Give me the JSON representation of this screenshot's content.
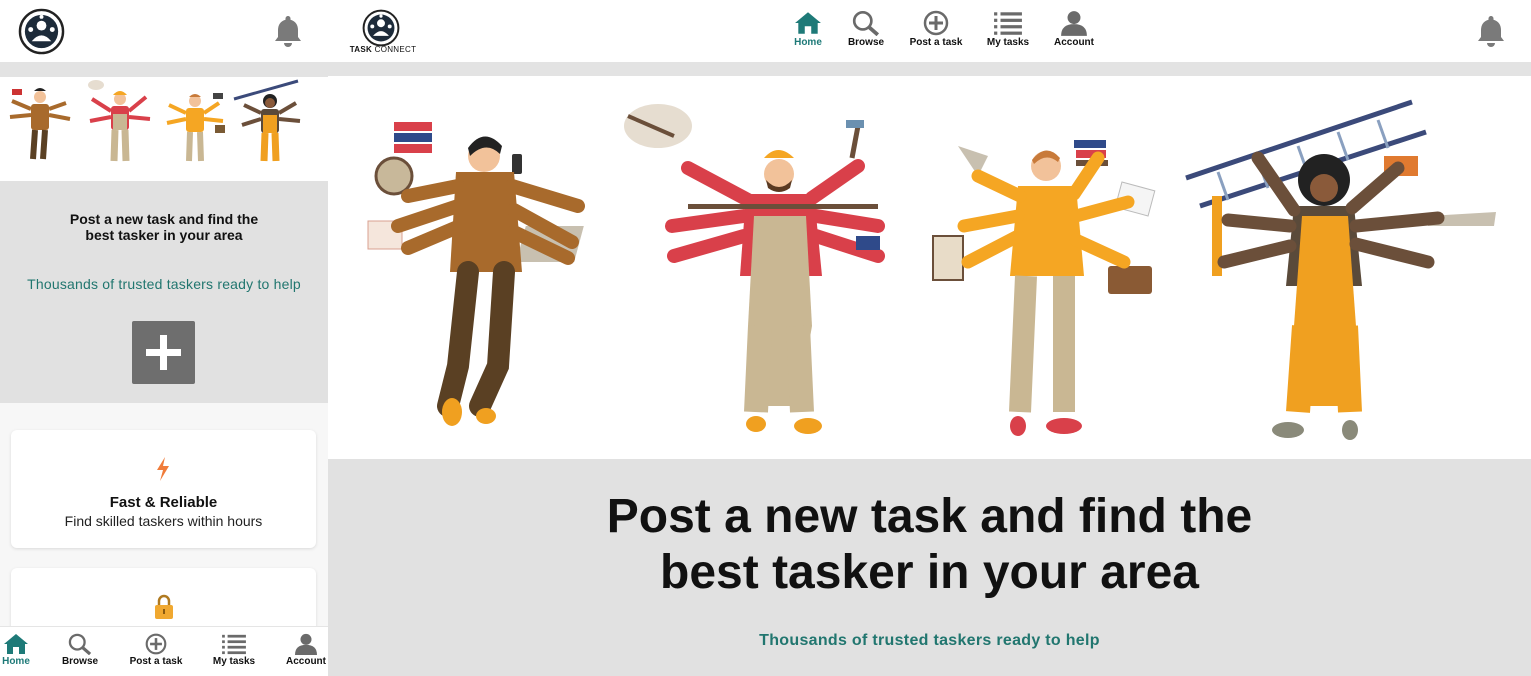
{
  "brand": {
    "logo_name": "TASK CONNECT",
    "logo_word1": "TASK",
    "logo_word2": "CONNECT"
  },
  "hero": {
    "title_line1": "Post a new task and find the",
    "title_line2": "best tasker in your area",
    "subtitle": "Thousands of trusted taskers ready to help"
  },
  "nav": [
    {
      "label": "Home",
      "icon": "home-icon",
      "active": true
    },
    {
      "label": "Browse",
      "icon": "search-icon",
      "active": false
    },
    {
      "label": "Post a task",
      "icon": "plus-circle-icon",
      "active": false
    },
    {
      "label": "My tasks",
      "icon": "list-icon",
      "active": false
    },
    {
      "label": "Account",
      "icon": "user-icon",
      "active": false
    }
  ],
  "features": [
    {
      "title": "Fast & Reliable",
      "description": "Find skilled taskers within hours",
      "icon": "lightning-icon"
    },
    {
      "title": "",
      "description": "",
      "icon": "lock-icon"
    }
  ],
  "colors": {
    "accent": "#1e7a78",
    "subtitle": "#21766f",
    "hero_band": "#e1e1e1",
    "plus_button": "#6e6e6e",
    "lightning": "#f07c3a",
    "lock": "#f0a830"
  }
}
